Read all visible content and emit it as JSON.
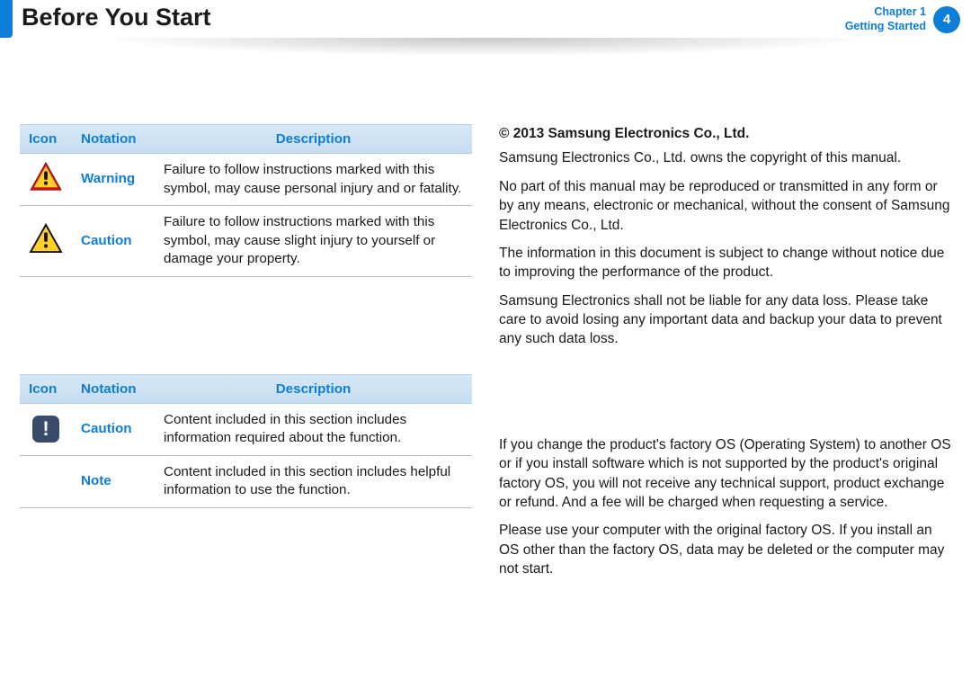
{
  "header": {
    "page_title": "Before You Start",
    "chapter_label": "Chapter 1",
    "section_label": "Getting Started",
    "page_number": "4"
  },
  "table1": {
    "headers": {
      "icon": "Icon",
      "notation": "Notation",
      "description": "Description"
    },
    "rows": [
      {
        "icon": "warning-triangle-red",
        "notation": "Warning",
        "description": "Failure to follow instructions marked with this symbol, may cause personal injury and or fatality."
      },
      {
        "icon": "warning-triangle-yellow",
        "notation": "Caution",
        "description": "Failure to follow instructions marked with this symbol, may cause slight injury to yourself or damage your property."
      }
    ]
  },
  "table2": {
    "headers": {
      "icon": "Icon",
      "notation": "Notation",
      "description": "Description"
    },
    "rows": [
      {
        "icon": "caution-box",
        "notation": "Caution",
        "description": "Content included in this section includes information required about the function."
      },
      {
        "icon": "",
        "notation": "Note",
        "description": "Content included in this section includes helpful information to use the function."
      }
    ]
  },
  "copyright": {
    "title": "© 2013 Samsung Electronics Co., Ltd.",
    "p1": "Samsung Electronics Co., Ltd. owns the copyright of this manual.",
    "p2": "No part of this manual may be reproduced or transmitted in any form or by any means, electronic or mechanical, without the consent of Samsung Electronics Co., Ltd.",
    "p3": "The information in this document is subject to change without notice due to improving the performance of the product.",
    "p4": "Samsung Electronics shall not be liable for any data loss. Please take care to avoid losing any important data and backup your data to prevent any such data loss."
  },
  "os_notice": {
    "p1": "If you change the product's factory OS (Operating System) to another OS or if you install software which is not supported by the product's original factory OS, you will not receive any technical support, product exchange or refund. And a fee will be charged when requesting a service.",
    "p2": "Please use your computer with the original factory OS. If you install an OS other than the factory OS, data may be deleted or the computer may not start."
  }
}
